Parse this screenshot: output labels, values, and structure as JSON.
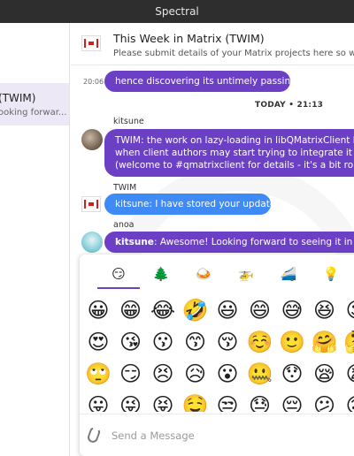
{
  "window": {
    "title": "Spectral"
  },
  "sidebar": {
    "active_room": {
      "name": "(TWIM)",
      "preview": "ooking forwar..."
    }
  },
  "room": {
    "title": "This Week in Matrix (TWIM)",
    "topic": "Please submit details of your Matrix projects here so we c"
  },
  "timeline": {
    "messages": [
      {
        "time": "20:06",
        "text": "hence discovering its untimely passing",
        "color": "purple"
      }
    ],
    "day_divider": "TODAY • 21:13",
    "events": [
      {
        "sender": "kitsune",
        "lines": [
          "TWIM: the work on lazy-loading in libQMatrixClient has a",
          "when client authors may start trying to integrate it in their",
          "(welcome to #qmatrixclient for details - it's a bit rough are"
        ],
        "color": "purple"
      },
      {
        "sender": "TWIM",
        "text": "kitsune: I have stored your update.",
        "color": "blue"
      },
      {
        "sender": "anoa",
        "mention": "kitsune",
        "text": ": Awesome! Looking forward to seeing it in quater",
        "color": "purple"
      }
    ]
  },
  "emoji_picker": {
    "categories": [
      {
        "icon": "smiling-face-icon",
        "glyph": "😏"
      },
      {
        "icon": "evergreen-tree-icon",
        "glyph": "🌲"
      },
      {
        "icon": "food-plate-icon",
        "glyph": "🍛"
      },
      {
        "icon": "helicopter-icon",
        "glyph": "🚁"
      },
      {
        "icon": "train-icon",
        "glyph": "🚄"
      },
      {
        "icon": "light-bulb-icon",
        "glyph": "💡"
      }
    ],
    "grid": [
      [
        "😀",
        "😁",
        "😂",
        "🤣",
        "😃",
        "😄",
        "😅",
        "😆",
        "😉"
      ],
      [
        "😍",
        "😘",
        "😗",
        "😙",
        "😚",
        "☺️",
        "🙂",
        "🤗",
        "🤔"
      ],
      [
        "🙄",
        "😏",
        "😣",
        "😥",
        "😮",
        "🤐",
        "😯",
        "😪",
        "😫"
      ],
      [
        "😛",
        "😜",
        "😝",
        "🤤",
        "😒",
        "😓",
        "😔",
        "😕",
        "🙃"
      ]
    ]
  },
  "composer": {
    "placeholder": "Send a Message"
  },
  "colors": {
    "accent": "#6b40c4",
    "bubble_blue": "#3f8af4",
    "titlebar": "#2e2e2e"
  }
}
